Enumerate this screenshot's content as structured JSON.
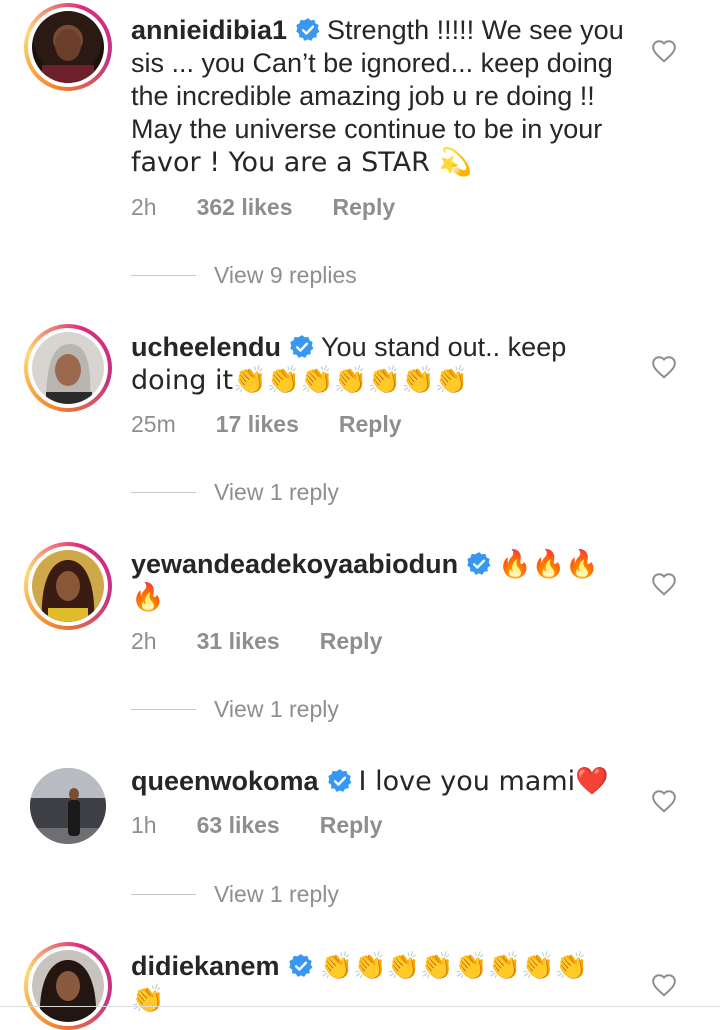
{
  "comments": [
    {
      "username": "annieidibia1",
      "text_lines": [
        "Strength !!!!! We see you",
        "sis ... you Can’t be ignored... keep doing",
        "the incredible amazing job u re  doing !!",
        "May the universe continue to be in your",
        "favor ! You are a STAR 💫"
      ],
      "time": "2h",
      "likes": "362 likes",
      "reply": "Reply",
      "view_replies": "View 9 replies"
    },
    {
      "username": "ucheelendu",
      "text_lines": [
        "You stand out.. keep",
        "doing it👏👏👏👏👏👏👏"
      ],
      "time": "25m",
      "likes": "17 likes",
      "reply": "Reply",
      "view_replies": "View 1 reply"
    },
    {
      "username": "yewandeadekoyaabiodun",
      "text_lines": [
        "🔥🔥🔥",
        "🔥"
      ],
      "time": "2h",
      "likes": "31 likes",
      "reply": "Reply",
      "view_replies": "View 1 reply"
    },
    {
      "username": "queenwokoma",
      "text_lines": [
        "I love you mami❤️"
      ],
      "time": "1h",
      "likes": "63 likes",
      "reply": "Reply",
      "view_replies": "View 1 reply"
    },
    {
      "username": "didiekanem",
      "text_lines": [
        "👏👏👏👏👏👏👏👏",
        "👏"
      ]
    }
  ],
  "icons": {
    "verified": "verified-badge-icon",
    "like": "heart-outline-icon"
  },
  "colors": {
    "verified_blue": "#3897f0",
    "meta_gray": "#8e8e8e",
    "text": "#262626",
    "heart_red": "#e0245e",
    "clap_yellow": "#f7c02a",
    "fire_orange": "#f46a1c"
  }
}
